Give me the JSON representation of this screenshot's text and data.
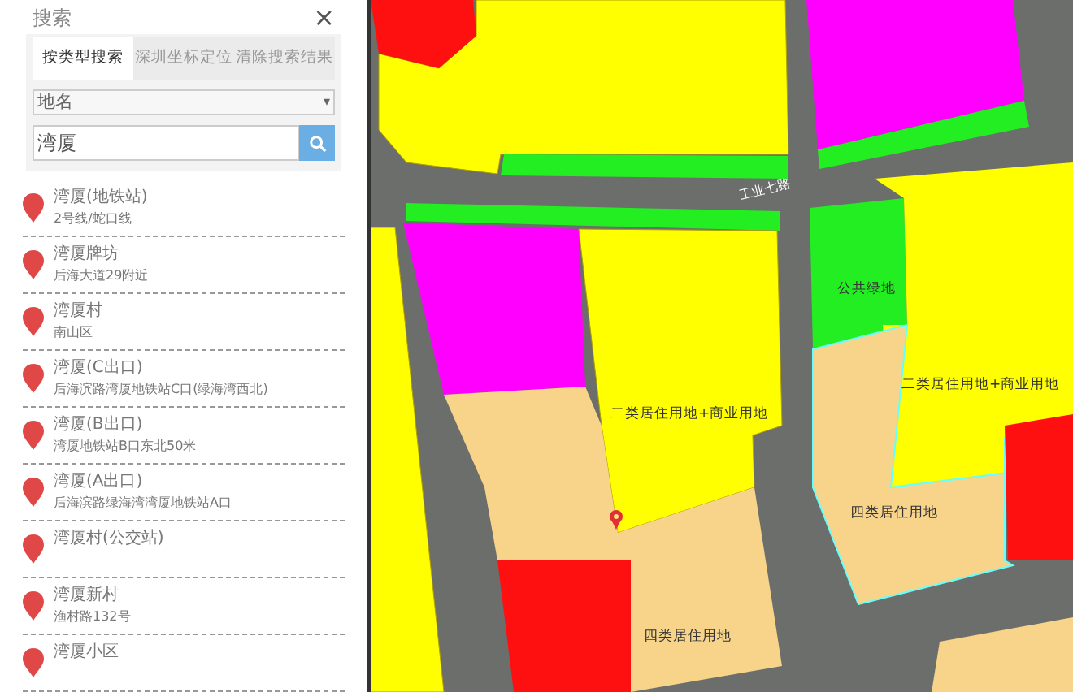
{
  "panel": {
    "title": "搜索",
    "close": "×",
    "tabs": [
      {
        "label": "按类型搜索",
        "selected": true
      },
      {
        "label": "深圳坐标定位",
        "selected": false
      },
      {
        "label": "清除搜索结果",
        "selected": false
      }
    ],
    "type_select": {
      "value": "地名",
      "caret": "▾"
    },
    "search": {
      "value": "湾厦"
    },
    "results": [
      {
        "name": "湾厦(地铁站)",
        "address": "2号线/蛇口线"
      },
      {
        "name": "湾厦牌坊",
        "address": "后海大道29附近"
      },
      {
        "name": "湾厦村",
        "address": "南山区"
      },
      {
        "name": "湾厦(C出口)",
        "address": "后海滨路湾厦地铁站C口(绿海湾西北)"
      },
      {
        "name": "湾厦(B出口)",
        "address": "湾厦地铁站B口东北50米"
      },
      {
        "name": "湾厦(A出口)",
        "address": "后海滨路绿海湾湾厦地铁站A口"
      },
      {
        "name": "湾厦村(公交站)"
      },
      {
        "name": "湾厦新村",
        "address": "渔村路132号"
      },
      {
        "name": "湾厦小区"
      }
    ]
  },
  "map": {
    "labels": [
      "工业七路",
      "公共绿地",
      "二类居住用地+商业用地",
      "二类居住用地+商业用地",
      "四类居住用地",
      "四类居住用地"
    ]
  }
}
